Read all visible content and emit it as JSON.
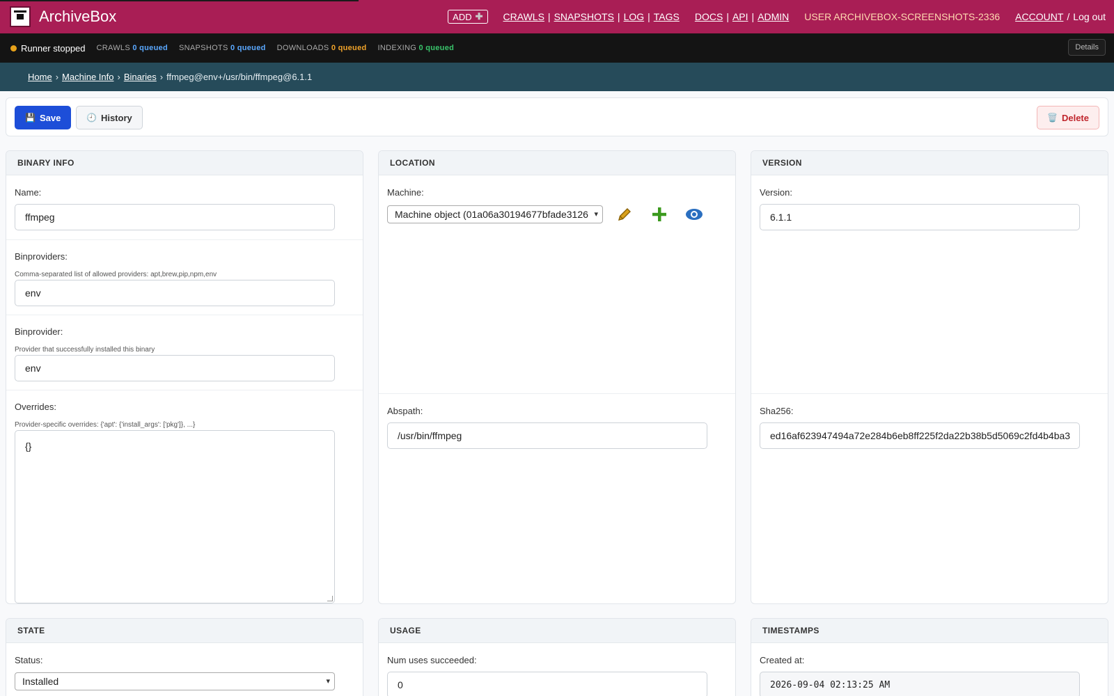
{
  "header": {
    "brand": "ArchiveBox",
    "add_label": "ADD",
    "nav1": [
      "CRAWLS",
      "SNAPSHOTS",
      "LOG",
      "TAGS"
    ],
    "nav2": [
      "DOCS",
      "API",
      "ADMIN"
    ],
    "user": "USER ARCHIVEBOX-SCREENSHOTS-2336",
    "account": "ACCOUNT",
    "logout": "Log out"
  },
  "statusbar": {
    "runner": "Runner stopped",
    "crawls_label": "CRAWLS",
    "crawls_count": "0 queued",
    "snapshots_label": "SNAPSHOTS",
    "snapshots_count": "0 queued",
    "downloads_label": "DOWNLOADS",
    "downloads_count": "0 queued",
    "indexing_label": "INDEXING",
    "indexing_count": "0 queued",
    "details": "Details"
  },
  "breadcrumb": {
    "home": "Home",
    "machine_info": "Machine Info",
    "binaries": "Binaries",
    "current": "ffmpeg@env+/usr/bin/ffmpeg@6.1.1"
  },
  "toolbar": {
    "save": "Save",
    "history": "History",
    "delete": "Delete"
  },
  "binary_info": {
    "title": "BINARY INFO",
    "name_label": "Name:",
    "name_value": "ffmpeg",
    "binproviders_label": "Binproviders:",
    "binproviders_help": "Comma-separated list of allowed providers: apt,brew,pip,npm,env",
    "binproviders_value": "env",
    "binprovider_label": "Binprovider:",
    "binprovider_help": "Provider that successfully installed this binary",
    "binprovider_value": "env",
    "overrides_label": "Overrides:",
    "overrides_help": "Provider-specific overrides: {'apt': {'install_args': ['pkg']}, ...}",
    "overrides_value": "{}"
  },
  "location": {
    "title": "LOCATION",
    "machine_label": "Machine:",
    "machine_value": "Machine object (01a06a30194677bfade3126",
    "abspath_label": "Abspath:",
    "abspath_value": "/usr/bin/ffmpeg"
  },
  "version": {
    "title": "VERSION",
    "version_label": "Version:",
    "version_value": "6.1.1",
    "sha_label": "Sha256:",
    "sha_value": "ed16af623947494a72e284b6eb8ff225f2da22b38b5d5069c2fd4b4ba3"
  },
  "state": {
    "title": "STATE",
    "status_label": "Status:",
    "status_value": "Installed"
  },
  "usage": {
    "title": "USAGE",
    "num_label": "Num uses succeeded:",
    "num_value": "0"
  },
  "timestamps": {
    "title": "TIMESTAMPS",
    "created_label": "Created at:",
    "created_value": "2026-09-04 02:13:25 AM"
  }
}
